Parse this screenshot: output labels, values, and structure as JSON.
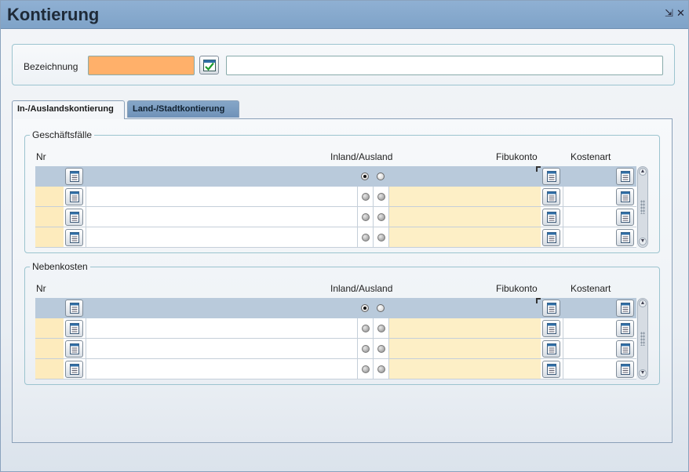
{
  "window": {
    "title": "Kontierung",
    "controls": {
      "minimize_glyph": "⇲",
      "close_glyph": "✕"
    }
  },
  "header": {
    "bezeichnung_label": "Bezeichnung",
    "bezeichnung_value": "",
    "bezeichnung_text_value": "",
    "accent_color": "#ffb06a"
  },
  "tabs": [
    {
      "label": "In-/Auslandskontierung",
      "active": true
    },
    {
      "label": "Land-/Stadtkontierung",
      "active": false
    }
  ],
  "groups": {
    "geschaeftsfaelle": {
      "title": "Geschäftsfälle",
      "columns": {
        "nr": "Nr",
        "inland_ausland": "Inland/Ausland",
        "fibukonto": "Fibukonto",
        "kostenart": "Kostenart"
      },
      "rows": [
        {
          "nr": "",
          "text": "",
          "inland": true,
          "ausland": false,
          "fibukonto": "",
          "kostenart": ""
        },
        {
          "nr": "",
          "text": "",
          "inland": false,
          "ausland": false,
          "fibukonto": "",
          "kostenart": ""
        },
        {
          "nr": "",
          "text": "",
          "inland": false,
          "ausland": false,
          "fibukonto": "",
          "kostenart": ""
        },
        {
          "nr": "",
          "text": "",
          "inland": false,
          "ausland": false,
          "fibukonto": "",
          "kostenart": ""
        }
      ]
    },
    "nebenkosten": {
      "title": "Nebenkosten",
      "columns": {
        "nr": "Nr",
        "inland_ausland": "Inland/Ausland",
        "fibukonto": "Fibukonto",
        "kostenart": "Kostenart"
      },
      "rows": [
        {
          "nr": "",
          "text": "",
          "inland": true,
          "ausland": false,
          "fibukonto": "",
          "kostenart": ""
        },
        {
          "nr": "",
          "text": "",
          "inland": false,
          "ausland": false,
          "fibukonto": "",
          "kostenart": ""
        },
        {
          "nr": "",
          "text": "",
          "inland": false,
          "ausland": false,
          "fibukonto": "",
          "kostenart": ""
        },
        {
          "nr": "",
          "text": "",
          "inland": false,
          "ausland": false,
          "fibukonto": "",
          "kostenart": ""
        }
      ]
    }
  },
  "icons": {
    "lookup": "list-document-icon",
    "confirm": "calendar-check-icon",
    "scroll_up": "▲",
    "scroll_down": "▼"
  },
  "colors": {
    "title_bar": "#7fa3c8",
    "nr_cell": "#fdebbd",
    "fibukonto_cell": "#fdefc6",
    "selected_row": "#b9cadb"
  }
}
